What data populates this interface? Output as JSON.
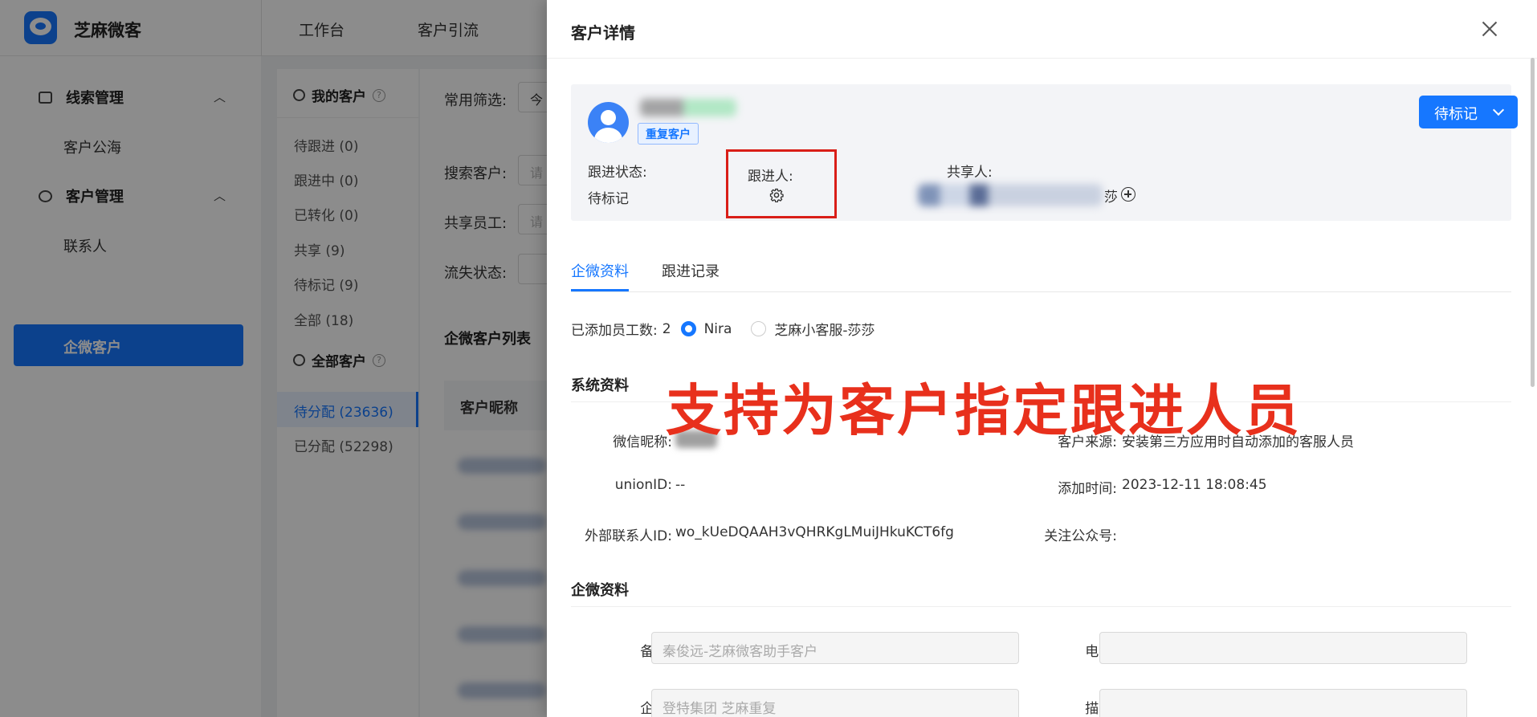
{
  "app": {
    "brand": "芝麻微客",
    "top_nav": [
      "工作台",
      "客户引流"
    ]
  },
  "sidebar": {
    "groups": [
      {
        "label": "线索管理",
        "items": [
          "客户公海"
        ]
      },
      {
        "label": "客户管理",
        "items": [
          "联系人",
          "企微客户"
        ]
      }
    ],
    "active_item": "企微客户"
  },
  "filter_panel": {
    "my_customers": {
      "title": "我的客户",
      "help": "?",
      "items": [
        "待跟进 (0)",
        "跟进中 (0)",
        "已转化 (0)",
        "共享 (9)",
        "待标记 (9)",
        "全部 (18)"
      ]
    },
    "all_customers": {
      "title": "全部客户",
      "help": "?",
      "items": [
        "待分配 (23636)",
        "已分配 (52298)"
      ],
      "selected": "待分配 (23636)"
    }
  },
  "main": {
    "common_filter_label": "常用筛选:",
    "common_filter_value": "今",
    "search_label": "搜索客户:",
    "search_placeholder": "请",
    "staff_label": "共享员工:",
    "staff_placeholder": "请",
    "lost_label": "流失状态:",
    "list_title": "企微客户列表",
    "column_nickname": "客户昵称"
  },
  "drawer": {
    "title": "客户详情",
    "customer": {
      "tag": "重复客户",
      "status_button": "待标记",
      "follow_status_label": "跟进状态:",
      "follow_status_value": "待标记",
      "follower_label": "跟进人:",
      "sharer_label": "共享人:",
      "sharer_suffix": "莎"
    },
    "tabs": [
      "企微资料",
      "跟进记录"
    ],
    "active_tab": "企微资料",
    "staff_added": {
      "label": "已添加员工数:",
      "count": "2",
      "options": [
        "Nira",
        "芝麻小客服-莎莎"
      ],
      "selected": "Nira"
    },
    "system_info": {
      "title": "系统资料",
      "wechat_nick_label": "微信昵称:",
      "source_label": "客户来源:",
      "source_value": "安装第三方应用时自动添加的客服人员",
      "union_label": "unionID:",
      "union_value": "--",
      "add_time_label": "添加时间:",
      "add_time_value": "2023-12-11 18:08:45",
      "external_id_label": "外部联系人ID:",
      "external_id_value": "wo_kUeDQAAH3vQHRKgLMuiJHkuKCT6fg",
      "follow_oa_label": "关注公众号:"
    },
    "wecom_info": {
      "title": "企微资料",
      "remark_label": "备注:",
      "remark_value": "秦俊远-芝麻微客助手客户",
      "phone_label": "电话:",
      "phone_value": "",
      "company_label": "企业:",
      "company_value": "登特集团 芝麻重复",
      "desc_label": "描述:",
      "desc_value": ""
    }
  },
  "annotation": {
    "text": "支持为客户指定跟进人员",
    "color": "#e8301c"
  },
  "colors": {
    "primary": "#1677ff",
    "highlight_border": "#d91e18"
  }
}
